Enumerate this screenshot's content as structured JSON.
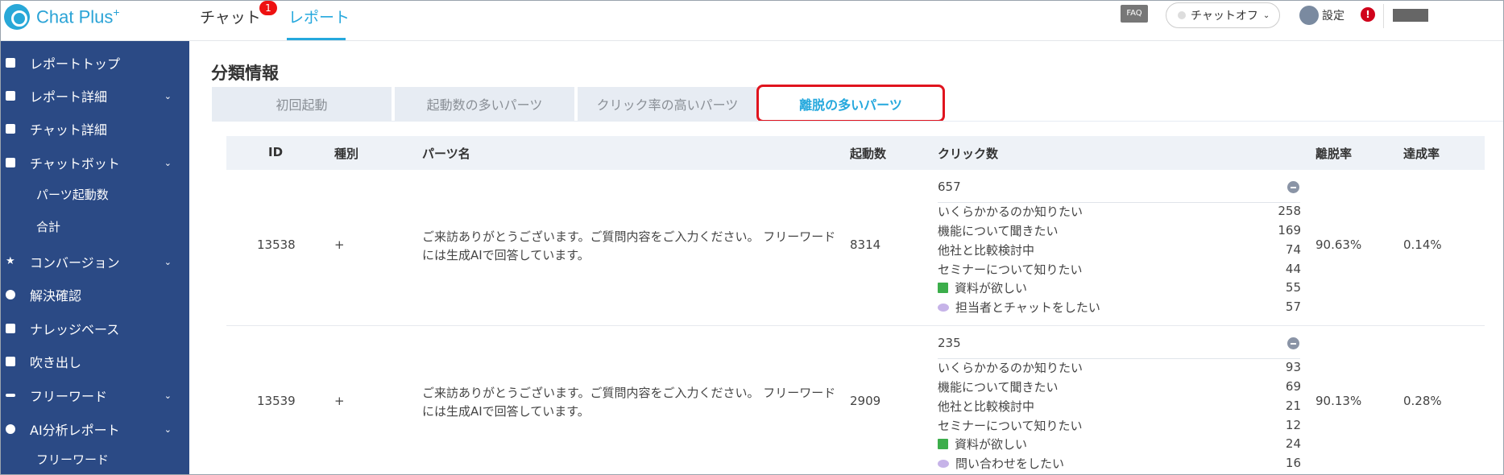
{
  "header": {
    "logo_text": "Chat Plus",
    "logo_sup": "+",
    "nav_chat": "チャット",
    "nav_chat_badge": "1",
    "nav_report": "レポート",
    "faq": "FAQ",
    "chat_status": "チャットオフ",
    "settings": "設定",
    "alert": "!"
  },
  "sidebar": {
    "items": [
      {
        "label": "レポートトップ"
      },
      {
        "label": "レポート詳細"
      },
      {
        "label": "チャット詳細"
      },
      {
        "label": "チャットボット"
      },
      {
        "label": "パーツ起動数"
      },
      {
        "label": "合計"
      },
      {
        "label": "コンバージョン"
      },
      {
        "label": "解決確認"
      },
      {
        "label": "ナレッジベース"
      },
      {
        "label": "吹き出し"
      },
      {
        "label": "フリーワード"
      },
      {
        "label": "AI分析レポート"
      },
      {
        "label": "フリーワード"
      }
    ]
  },
  "main": {
    "title": "分類情報",
    "tabs": [
      {
        "label": "初回起動"
      },
      {
        "label": "起動数の多いパーツ"
      },
      {
        "label": "クリック率の高いパーツ"
      },
      {
        "label": "離脱の多いパーツ"
      }
    ],
    "columns": {
      "id": "ID",
      "type": "種別",
      "name": "パーツ名",
      "launches": "起動数",
      "clicks": "クリック数",
      "bounce": "離脱率",
      "achieve": "達成率"
    },
    "rows": [
      {
        "id": "13538",
        "type": "+",
        "name": "ご来訪ありがとうございます。ご質問内容をご入力ください。 フリーワードには生成AIで回答しています。",
        "launches": "8314",
        "click_total": "657",
        "options": [
          {
            "label": "いくらかかるのか知りたい",
            "value": "258"
          },
          {
            "label": "機能について聞きたい",
            "value": "169"
          },
          {
            "label": "他社と比較検討中",
            "value": "74"
          },
          {
            "label": "セミナーについて知りたい",
            "value": "44"
          },
          {
            "label": "資料が欲しい",
            "value": "55"
          },
          {
            "label": "担当者とチャットをしたい",
            "value": "57"
          }
        ],
        "bounce": "90.63%",
        "achieve": "0.14%"
      },
      {
        "id": "13539",
        "type": "+",
        "name": "ご来訪ありがとうございます。ご質問内容をご入力ください。 フリーワードには生成AIで回答しています。",
        "launches": "2909",
        "click_total": "235",
        "options": [
          {
            "label": "いくらかかるのか知りたい",
            "value": "93"
          },
          {
            "label": "機能について聞きたい",
            "value": "69"
          },
          {
            "label": "他社と比較検討中",
            "value": "21"
          },
          {
            "label": "セミナーについて知りたい",
            "value": "12"
          },
          {
            "label": "資料が欲しい",
            "value": "24"
          },
          {
            "label": "問い合わせをしたい",
            "value": "16"
          }
        ],
        "bounce": "90.13%",
        "achieve": "0.28%"
      }
    ]
  }
}
